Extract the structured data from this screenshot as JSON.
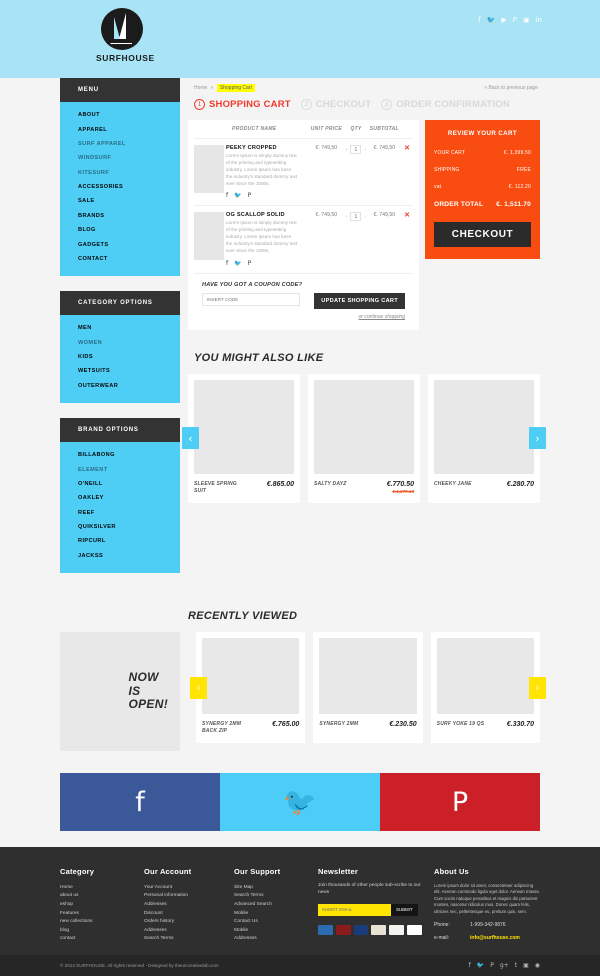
{
  "header": {
    "brand": "SURFHOUSE",
    "social": [
      "f",
      "🐦",
      "▶",
      "P",
      "▣",
      "in"
    ]
  },
  "sidebar": {
    "menu": {
      "title": "MENU",
      "items": [
        {
          "label": "ABOUT",
          "dim": false
        },
        {
          "label": "APPAREL",
          "dim": false
        },
        {
          "label": "SURF APPAREL",
          "dim": true
        },
        {
          "label": "WINDSURF",
          "dim": true
        },
        {
          "label": "KITESURF",
          "dim": true
        },
        {
          "label": "ACCESSORIES",
          "dim": false
        },
        {
          "label": "SALE",
          "dim": false
        },
        {
          "label": "BRANDS",
          "dim": false
        },
        {
          "label": "BLOG",
          "dim": false
        },
        {
          "label": "GADGETS",
          "dim": false
        },
        {
          "label": "CONTACT",
          "dim": false
        }
      ]
    },
    "category": {
      "title": "CATEGORY OPTIONS",
      "items": [
        {
          "label": "MEN",
          "dim": false
        },
        {
          "label": "WOMEN",
          "dim": true
        },
        {
          "label": "KIDS",
          "dim": false
        },
        {
          "label": "WETSUITS",
          "dim": false
        },
        {
          "label": "OUTERWEAR",
          "dim": false
        }
      ]
    },
    "brand": {
      "title": "BRAND OPTIONS",
      "items": [
        {
          "label": "BILLABONG",
          "dim": false
        },
        {
          "label": "ELEMENT",
          "dim": true
        },
        {
          "label": "O'NEILL",
          "dim": false
        },
        {
          "label": "OAKLEY",
          "dim": false
        },
        {
          "label": "REEF",
          "dim": false
        },
        {
          "label": "QUIKSILVER",
          "dim": false
        },
        {
          "label": "RIPCURL",
          "dim": false
        },
        {
          "label": "JACKSS",
          "dim": false
        }
      ]
    }
  },
  "breadcrumb": {
    "home": "Home",
    "separator": "»",
    "current": "Shopping Cart",
    "back": "« Back to previous page"
  },
  "steps": [
    {
      "num": "1",
      "label": "SHOPPING CART",
      "active": true
    },
    {
      "num": "2",
      "label": "CHECKOUT",
      "active": false
    },
    {
      "num": "3",
      "label": "ORDER CONFIRMATION",
      "active": false
    }
  ],
  "cart": {
    "headers": [
      "PRODUCT NAME",
      "UNIT PRICE",
      "QTY",
      "SUBTOTAL"
    ],
    "description": "Lorem Ipsum is simply dummy text of the printing and typesetting industry. Lorem Ipsum has been the industry's standard dummy text ever since the 1500s,",
    "share_icons": [
      "f",
      "🐦",
      "P"
    ],
    "remove_icon": "✕",
    "dec": "‹",
    "inc": "›",
    "rows": [
      {
        "name": "PEEKY CROPPED",
        "unit_price": "€. 749,50",
        "qty": "1",
        "subtotal": "€. 749,50"
      },
      {
        "name": "OG SCALLOP SOLID",
        "unit_price": "€. 749,50",
        "qty": "1",
        "subtotal": "€. 749,50"
      }
    ]
  },
  "summary": {
    "title": "REVIEW YOUR CART",
    "rows": [
      {
        "label": "YOUR CART",
        "value": "€. 1,399.50"
      },
      {
        "label": "SHIPPING",
        "value": "FREE"
      },
      {
        "label": "vat",
        "value": "€. 112.20"
      }
    ],
    "total_label": "ORDER TOTAL",
    "total_value": "€. 1,511.70",
    "checkout": "CHECKOUT"
  },
  "coupon": {
    "title": "HAVE YOU GOT A COUPON CODE?",
    "placeholder": "INSERT CODE",
    "value": "",
    "update": "UPDATE SHOPPING CART",
    "continue": "or continue shopping"
  },
  "also_like": {
    "title": "YOU MIGHT ALSO LIKE",
    "prev": "‹",
    "next": "›",
    "items": [
      {
        "name": "SLEEVE SPRING SUIT",
        "price": "€.865.00",
        "old_price": ""
      },
      {
        "name": "SALTY DAYZ",
        "price": "€.770.50",
        "old_price": "€.1,270.18"
      },
      {
        "name": "CHEEKY JANE",
        "price": "€.280.70",
        "old_price": ""
      }
    ]
  },
  "recently_viewed": {
    "title": "RECENTLY VIEWED",
    "banner": "NOW\nIS\nOPEN!",
    "prev": "‹",
    "next": "›",
    "items": [
      {
        "name": "SYNERGY 2MM BACK ZIP",
        "price": "€.765.00",
        "old_price": ""
      },
      {
        "name": "SYNERGY 2MM",
        "price": "€.230.50",
        "old_price": ""
      },
      {
        "name": "SURF YOKE 19 QS",
        "price": "€.330.70",
        "old_price": ""
      }
    ]
  },
  "social_strip": [
    {
      "name": "facebook",
      "glyph": "f",
      "color": "#3b5998"
    },
    {
      "name": "twitter",
      "glyph": "🐦",
      "color": "#4ccdf7"
    },
    {
      "name": "pinterest",
      "glyph": "P",
      "color": "#cb2027"
    }
  ],
  "footer": {
    "category": {
      "title": "Category",
      "links": [
        "Home",
        "about us",
        "eshop",
        "Features",
        "new collections",
        "blog",
        "contact"
      ]
    },
    "account": {
      "title": "Our Account",
      "links": [
        "Your Account",
        "Personal information",
        "Addresses",
        "Discount",
        "Orders history",
        "Addresses",
        "Search Terms"
      ]
    },
    "support": {
      "title": "Our Support",
      "links": [
        "Site Map",
        "Search Terms",
        "Advanced Search",
        "Mobile",
        "Contact Us",
        "Mobile",
        "Addresses"
      ]
    },
    "newsletter": {
      "title": "Newsletter",
      "subtitle": "Join thousands of other people sub-scribe to our news",
      "placeholder": "INSERT EMAIL",
      "value": "",
      "submit": "SUBMIT",
      "payments": [
        "AMEX",
        "MC",
        "MAESTRO",
        "PayPal",
        "DISCOVER",
        "VISA"
      ]
    },
    "about": {
      "title": "About Us",
      "text": "Lorem ipsum dolor sit amet, consectetuer adipiscing elit. Aenean commodo ligula eget dolor. Aenean massa. Cum sociis natoque penatibus et magnis dis parturient montes, nascetur ridiculus mus. Donec quam felis, ultricies nec, pellentesque eu, pretium quis, sem.",
      "phone_label": "Phone:",
      "phone": "1-999-342-9876",
      "email_label": "e-mail:",
      "email": "info@surfhouse.com"
    }
  },
  "copyright": {
    "text": "© 2014  SURFHOUSE. All rights reserved - Designed by theuncreativelab.com",
    "social": [
      "f",
      "🐦",
      "P",
      "g+",
      "t",
      "▣",
      "◉"
    ]
  }
}
